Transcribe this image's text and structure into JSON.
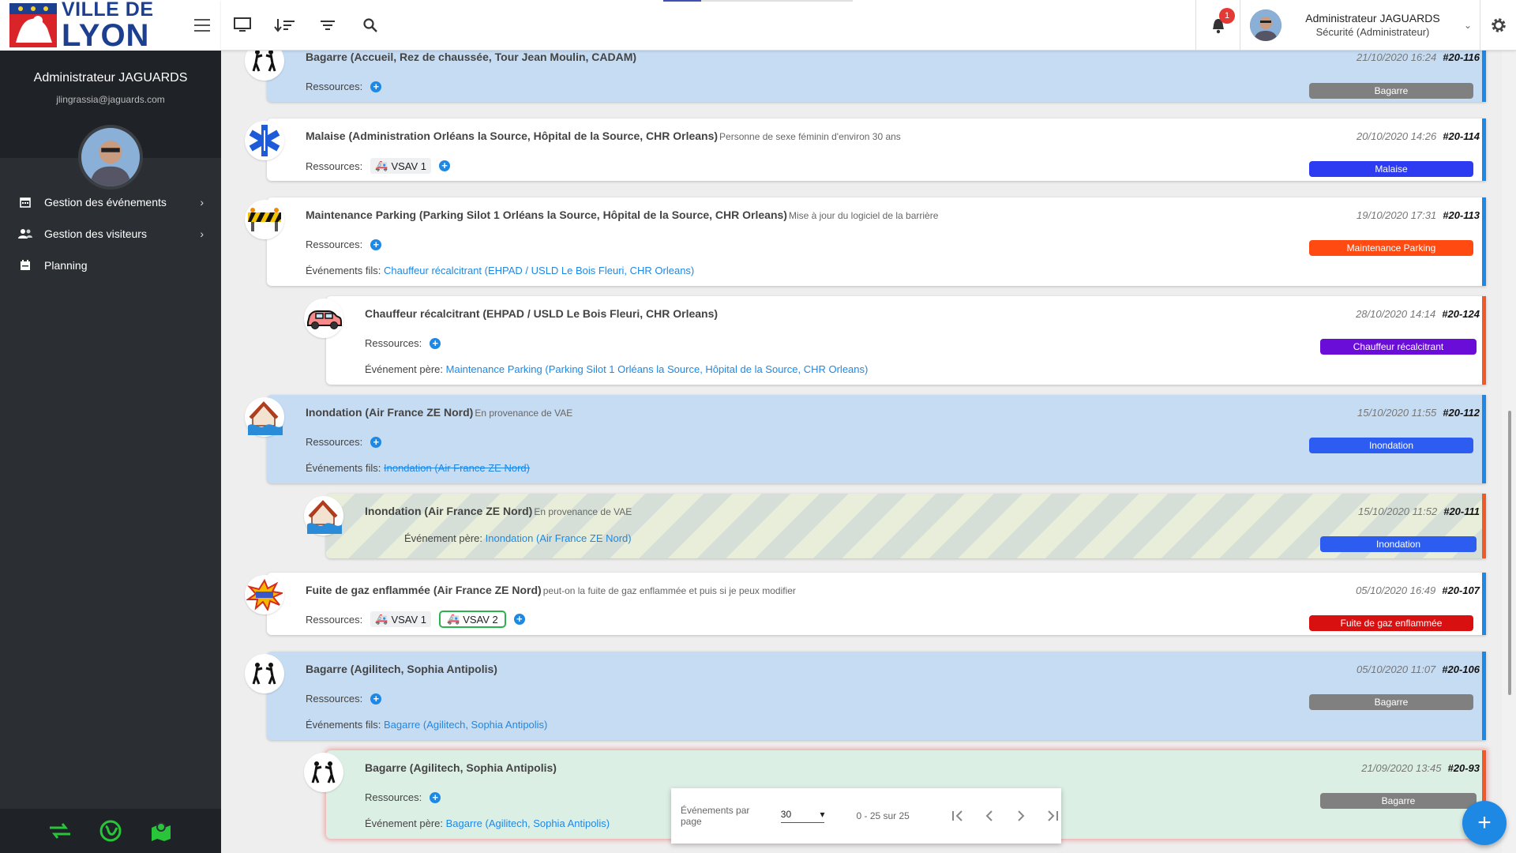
{
  "brand": {
    "line1": "VILLE DE",
    "line2": "LYON"
  },
  "sidebar": {
    "user_name": "Administrateur JAGUARDS",
    "user_email": "jlingrassia@jaguards.com",
    "items": [
      {
        "label": "Gestion des événements",
        "icon": "calendar-icon",
        "has_chevron": true
      },
      {
        "label": "Gestion des visiteurs",
        "icon": "users-icon",
        "has_chevron": true
      },
      {
        "label": "Planning",
        "icon": "planning-icon",
        "has_chevron": false
      }
    ],
    "footer_icons": [
      "swap-icon",
      "globe-icon",
      "map-marker-icon"
    ],
    "footer_icon_color": "#28c43a"
  },
  "topbar": {
    "icons": [
      "monitor-icon",
      "sort-icon",
      "filter-icon",
      "search-icon"
    ],
    "notifications_count": "1",
    "user_name": "Administrateur JAGUARDS",
    "user_role": "Sécurité (Administrateur)"
  },
  "labels": {
    "resources": "Ressources:",
    "child_events": "Événements fils:",
    "parent_event": "Événement père:"
  },
  "events": [
    {
      "title": "Bagarre (Accueil, Rez de chaussée, Tour Jean Moulin, CADAM)",
      "description": "",
      "date": "21/10/2020 16:24",
      "id": "#20-116",
      "resources": [],
      "tag": "Bagarre",
      "tag_color": "#808080",
      "bar_color": "#1e88e5",
      "icon": "fight-icon"
    },
    {
      "title": "Malaise (Administration Orléans la Source, Hôpital de la Source, CHR Orleans)",
      "description": "Personne de sexe féminin d'environ 30 ans",
      "date": "20/10/2020 14:26",
      "id": "#20-114",
      "resources": [
        "VSAV 1"
      ],
      "tag": "Malaise",
      "tag_color": "#2d3cf0",
      "bar_color": "#1e88e5",
      "icon": "medical-star-icon"
    },
    {
      "title": "Maintenance Parking (Parking Silot 1 Orléans la Source, Hôpital de la Source, CHR Orleans)",
      "description": "Mise à jour du logiciel de la barrière",
      "date": "19/10/2020 17:31",
      "id": "#20-113",
      "resources": [],
      "tag": "Maintenance Parking",
      "tag_color": "#ff4a12",
      "bar_color": "#1e88e5",
      "icon": "barrier-icon",
      "child_link": "Chauffeur récalcitrant (EHPAD / USLD Le Bois Fleuri, CHR Orleans)"
    },
    {
      "title": "Chauffeur récalcitrant (EHPAD / USLD Le Bois Fleuri, CHR Orleans)",
      "description": "",
      "date": "28/10/2020 14:14",
      "id": "#20-124",
      "resources": [],
      "tag": "Chauffeur récalcitrant",
      "tag_color": "#6a0dd9",
      "bar_color": "#f05a28",
      "icon": "car-icon",
      "parent_link": "Maintenance Parking (Parking Silot 1 Orléans la Source, Hôpital de la Source, CHR Orleans)"
    },
    {
      "title": "Inondation (Air France ZE Nord)",
      "description": "En provenance de VAE",
      "date": "15/10/2020 11:55",
      "id": "#20-112",
      "resources": [],
      "tag": "Inondation",
      "tag_color": "#2d5cf0",
      "bar_color": "#1e88e5",
      "icon": "flood-icon",
      "child_link": "Inondation (Air France ZE Nord)"
    },
    {
      "title": "Inondation (Air France ZE Nord)",
      "description": "En provenance de VAE",
      "date": "15/10/2020 11:52",
      "id": "#20-111",
      "tag": "Inondation",
      "tag_color": "#2d5cf0",
      "bar_color": "#f05a28",
      "icon": "flood-icon",
      "parent_link": "Inondation (Air France ZE Nord)"
    },
    {
      "title": "Fuite de gaz enflammée (Air France ZE Nord)",
      "description": "peut-on la fuite de gaz enflammée et puis si je peux modifier",
      "date": "05/10/2020 16:49",
      "id": "#20-107",
      "resources": [
        "VSAV 1",
        "VSAV 2"
      ],
      "tag": "Fuite de gaz enflammée",
      "tag_color": "#d81010",
      "bar_color": "#1e88e5",
      "icon": "explosion-icon"
    },
    {
      "title": "Bagarre (Agilitech, Sophia Antipolis)",
      "description": "",
      "date": "05/10/2020 11:07",
      "id": "#20-106",
      "resources": [],
      "tag": "Bagarre",
      "tag_color": "#808080",
      "bar_color": "#1e88e5",
      "icon": "fight-icon",
      "child_link": "Bagarre (Agilitech, Sophia Antipolis)"
    },
    {
      "title": "Bagarre (Agilitech, Sophia Antipolis)",
      "description": "",
      "date": "21/09/2020 13:45",
      "id": "#20-93",
      "resources": [],
      "tag": "Bagarre",
      "tag_color": "#808080",
      "bar_color": "#f05a28",
      "icon": "fight-icon",
      "parent_link": "Bagarre (Agilitech, Sophia Antipolis)"
    }
  ],
  "paginator": {
    "per_page_label": "Événements par page",
    "per_page_value": "30",
    "range": "0 - 25 sur 25"
  },
  "fab_label": "+"
}
